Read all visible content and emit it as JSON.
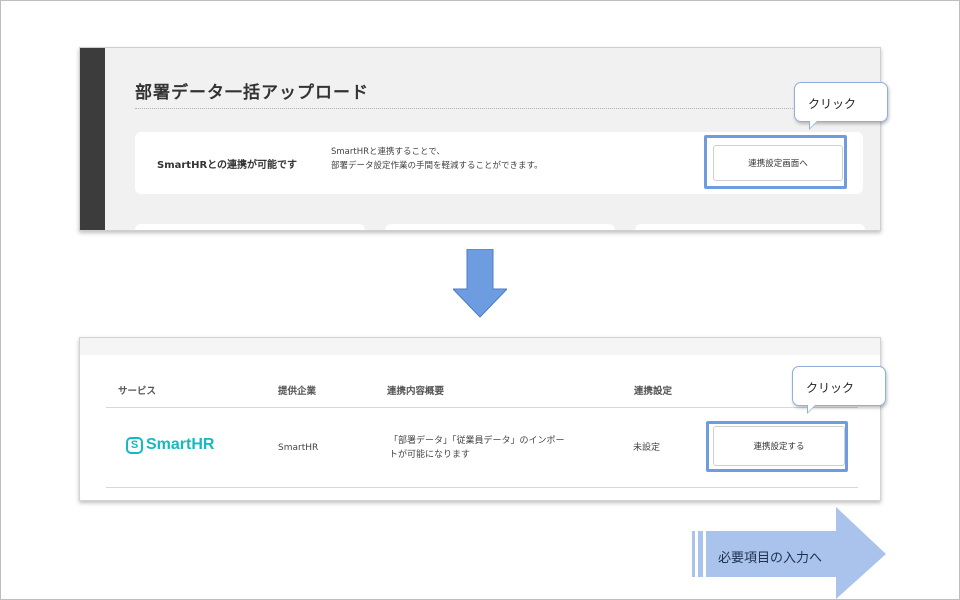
{
  "panel1": {
    "title": "部署データ一括アップロード",
    "card_label": "SmartHRとの連携が可能です",
    "card_desc_line1": "SmartHRと連携することで、",
    "card_desc_line2": "部署データ設定作業の手間を軽減することができます。",
    "button_label": "連携設定画面へ"
  },
  "callout1": {
    "text": "クリック"
  },
  "panel2": {
    "headers": [
      "サービス",
      "提供企業",
      "連携内容概要",
      "連携設定"
    ],
    "row": {
      "logo_text": "SmartHR",
      "logo_mark": "S",
      "company": "SmartHR",
      "summary_line1": "「部署データ」「従業員データ」のインポー",
      "summary_line2": "トが可能になります",
      "status": "未設定",
      "button_label": "連携設定する"
    }
  },
  "callout2": {
    "text": "クリック"
  },
  "next_step": {
    "label": "必要項目の入力へ"
  },
  "colors": {
    "highlight": "#6d9de0",
    "arrow": "#6d9de0",
    "brand": "#15b9c0",
    "sidebar": "#3c3c3c"
  }
}
